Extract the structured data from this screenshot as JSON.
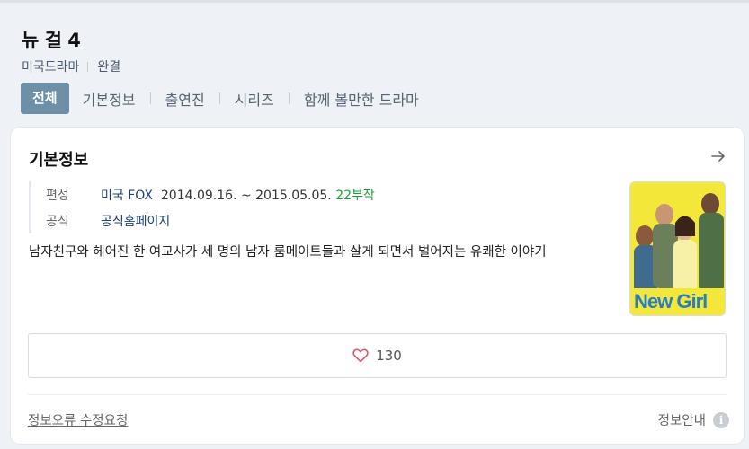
{
  "header": {
    "title": "뉴 걸 4",
    "genre": "미국드라마",
    "status": "완결"
  },
  "tabs": [
    {
      "label": "전체",
      "active": true
    },
    {
      "label": "기본정보",
      "active": false
    },
    {
      "label": "출연진",
      "active": false
    },
    {
      "label": "시리즈",
      "active": false
    },
    {
      "label": "함께 볼만한 드라마",
      "active": false
    }
  ],
  "card": {
    "title": "기본정보",
    "arrow_icon": "arrow-right-icon",
    "broadcast": {
      "label": "편성",
      "network": "미국 FOX",
      "dates": "2014.09.16. ~ 2015.05.05.",
      "episodes": "22부작"
    },
    "official": {
      "label": "공식",
      "link_text": "공식홈페이지"
    },
    "description": "남자친구와 헤어진 한 여교사가 세 명의 남자 룸메이트들과 살게 되면서 벌어지는 유쾌한 이야기",
    "poster": {
      "logo_text": "New Girl"
    },
    "likes": {
      "icon": "heart-icon",
      "count": "130"
    },
    "footer": {
      "report_label": "정보오류 수정요청",
      "guide_label": "정보안내",
      "guide_icon": "info-icon"
    }
  },
  "colors": {
    "active_tab_bg": "#6d8fa7",
    "link": "#1e3f75",
    "episodes_green": "#17a534",
    "heart": "#e2566c",
    "poster_bg": "#f3e83a"
  }
}
